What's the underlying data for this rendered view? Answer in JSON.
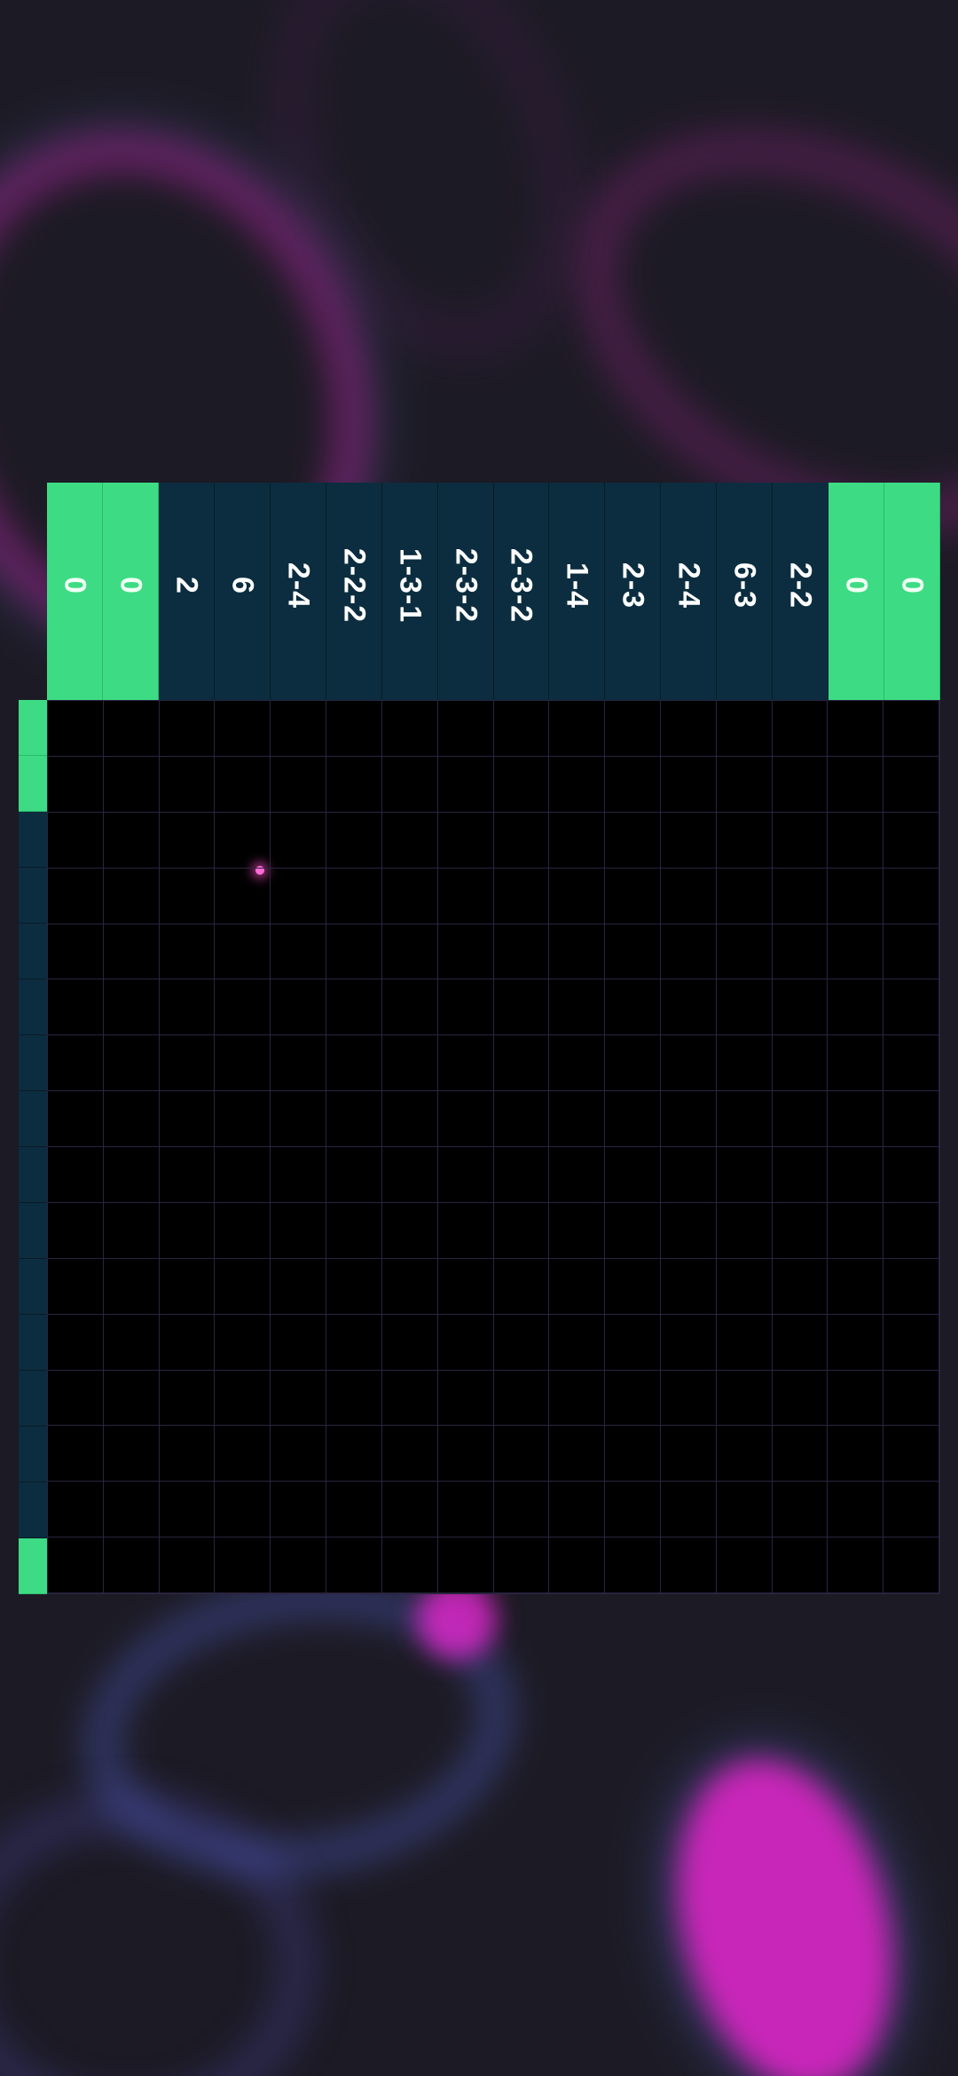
{
  "puzzle": {
    "column_clues": [
      "0",
      "0",
      "2",
      "6",
      "2-4",
      "2-2-2",
      "1-3-1",
      "2-3-2",
      "2-3-2",
      "1-4",
      "2-3",
      "2-4",
      "6-3",
      "2-2",
      "0",
      "0"
    ],
    "column_solved": [
      true,
      true,
      false,
      false,
      false,
      false,
      false,
      false,
      false,
      false,
      false,
      false,
      false,
      false,
      true,
      true
    ],
    "row_solved": [
      true,
      true,
      false,
      false,
      false,
      false,
      false,
      false,
      false,
      false,
      false,
      false,
      false,
      false,
      false,
      true
    ],
    "grid_size": 16
  },
  "colors": {
    "solved": "#3ddc84",
    "unsolved": "#0b2d3f",
    "cell": "#000000",
    "gridline": "#2a2440"
  }
}
